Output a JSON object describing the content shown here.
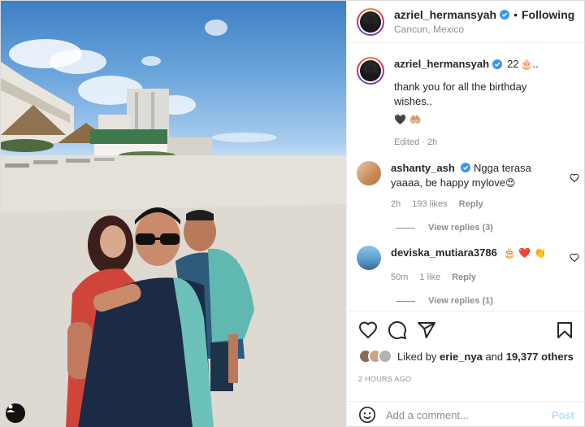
{
  "post": {
    "author": "azriel_hermansyah",
    "follow_state": "Following",
    "location": "Cancun, Mexico"
  },
  "caption": {
    "username": "azriel_hermansyah",
    "text_prefix": "22",
    "text_suffix": "..",
    "line2": "thank you for all the birthday wishes..",
    "emojis": "🖤 🤲🏼",
    "meta": "Edited · 2h"
  },
  "comments": [
    {
      "username": "ashanty_ash",
      "text": "Ngga terasa yaaaa, be happy mylove",
      "emoji": "😍",
      "time": "2h",
      "likes": "193 likes",
      "reply_label": "Reply",
      "view_replies": "View replies (3)"
    },
    {
      "username": "deviska_mutiara3786",
      "text": "",
      "emoji": "🎂 ❤️ 👏",
      "time": "50m",
      "likes": "1 like",
      "reply_label": "Reply",
      "view_replies": "View replies (1)"
    }
  ],
  "likes": {
    "prefix": "Liked by",
    "user": "erie_nya",
    "joiner": "and",
    "count": "19,377 others"
  },
  "time_ago": "2 HOURS AGO",
  "composer": {
    "placeholder": "Add a comment...",
    "post_label": "Post"
  },
  "colors": {
    "verified": "#3897f0",
    "muted": "#8e8e8e",
    "post_disabled": "#b2dffc"
  },
  "icons": [
    "heart-icon",
    "comment-icon",
    "share-icon",
    "bookmark-icon",
    "smile-icon",
    "verified-icon",
    "user-icon"
  ]
}
